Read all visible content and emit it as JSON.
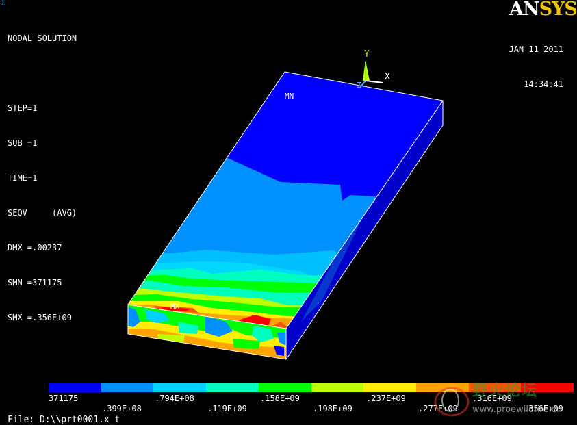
{
  "window": {
    "number": "1"
  },
  "info": {
    "lines": [
      "NODAL SOLUTION",
      "",
      "STEP=1",
      "SUB =1",
      "TIME=1",
      "SEQV     (AVG)",
      "DMX =.00237",
      "SMN =371175",
      "SMX =.356E+09"
    ]
  },
  "datetime": {
    "date": "JAN 11 2011",
    "time": "14:34:41"
  },
  "logo": {
    "part1": "AN",
    "part2": "SYS"
  },
  "triad": {
    "y_label": "Y",
    "x_label": "X",
    "z_label": "Z"
  },
  "model": {
    "min_label": "MN",
    "max_label": "MX"
  },
  "legend": {
    "colors": [
      "#0000ff",
      "#0091ff",
      "#00d2ff",
      "#00ffbe",
      "#00ff00",
      "#bfff00",
      "#ffee00",
      "#ffa300",
      "#ff4f00",
      "#ff0000"
    ],
    "labels_top": [
      "371175",
      ".794E+08",
      ".158E+09",
      ".237E+09",
      ".316E+09"
    ],
    "labels_bottom": [
      ".399E+08",
      ".119E+09",
      ".198E+09",
      ".277E+09",
      ".356E+09"
    ]
  },
  "file": {
    "label": "File: D:\\\\prt0001.x_t"
  },
  "watermark": {
    "title": "野火论坛",
    "url": "www.proewildfire.cn"
  }
}
